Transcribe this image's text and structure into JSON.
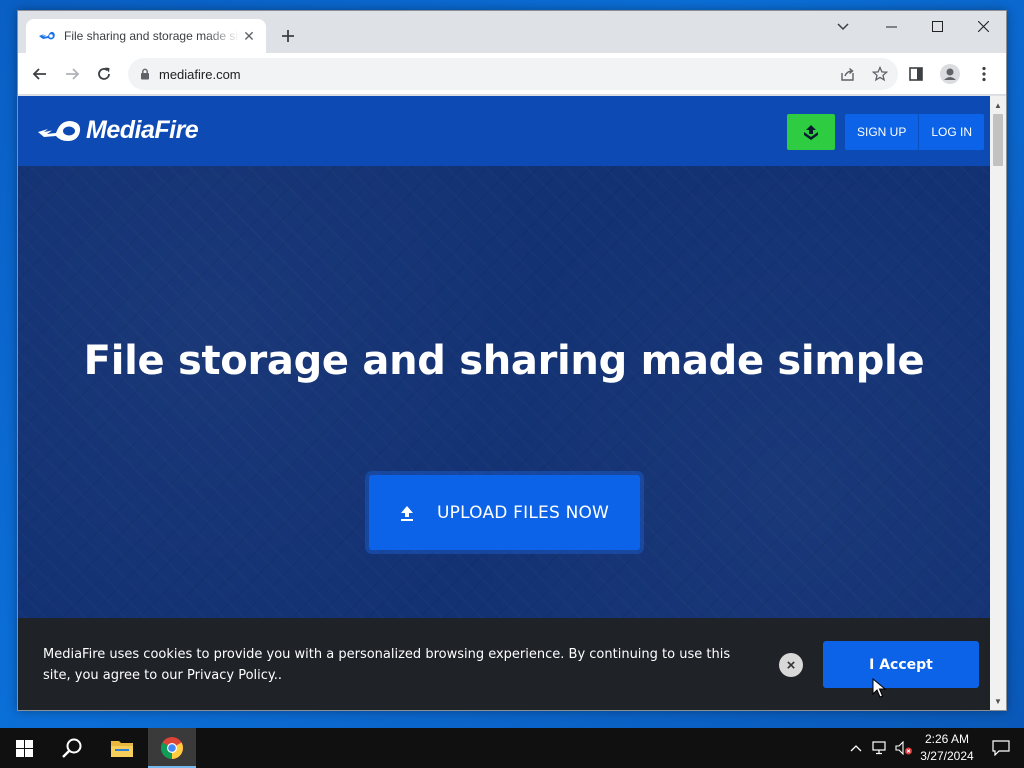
{
  "browser": {
    "tab_title": "File sharing and storage made simple",
    "tab_close": "✕",
    "url": "mediafire.com"
  },
  "site": {
    "brand": "MediaFire",
    "sign_up": "SIGN UP",
    "log_in": "LOG IN",
    "hero_title": "File storage and sharing made simple",
    "hero_upload": "UPLOAD FILES NOW"
  },
  "cookie": {
    "message": "MediaFire uses cookies to provide you with a personalized browsing experience. By continuing to use this site, you agree to our Privacy Policy..",
    "close": "×",
    "accept": "I Accept"
  },
  "taskbar": {
    "time": "2:26 AM",
    "date": "3/27/2024"
  },
  "colors": {
    "site_header": "#0e4ab3",
    "hero_bg": "#133274",
    "primary_button": "#0c63e7",
    "upload_icon_button": "#2ecc40",
    "cookie_banner": "#1f2227"
  },
  "icons": {
    "tab_favicon": "mediafire-flame-icon",
    "new_tab": "plus-icon",
    "back": "arrow-left-icon",
    "forward": "arrow-right-icon",
    "reload": "reload-icon",
    "lock": "lock-icon",
    "share": "share-icon",
    "bookmark": "star-icon",
    "side_panel": "side-panel-icon",
    "profile": "profile-icon",
    "menu": "kebab-menu-icon",
    "upload": "upload-icon",
    "start": "windows-logo-icon",
    "search": "search-icon",
    "explorer": "folder-icon",
    "chrome": "chrome-icon",
    "notifications": "notification-icon"
  }
}
